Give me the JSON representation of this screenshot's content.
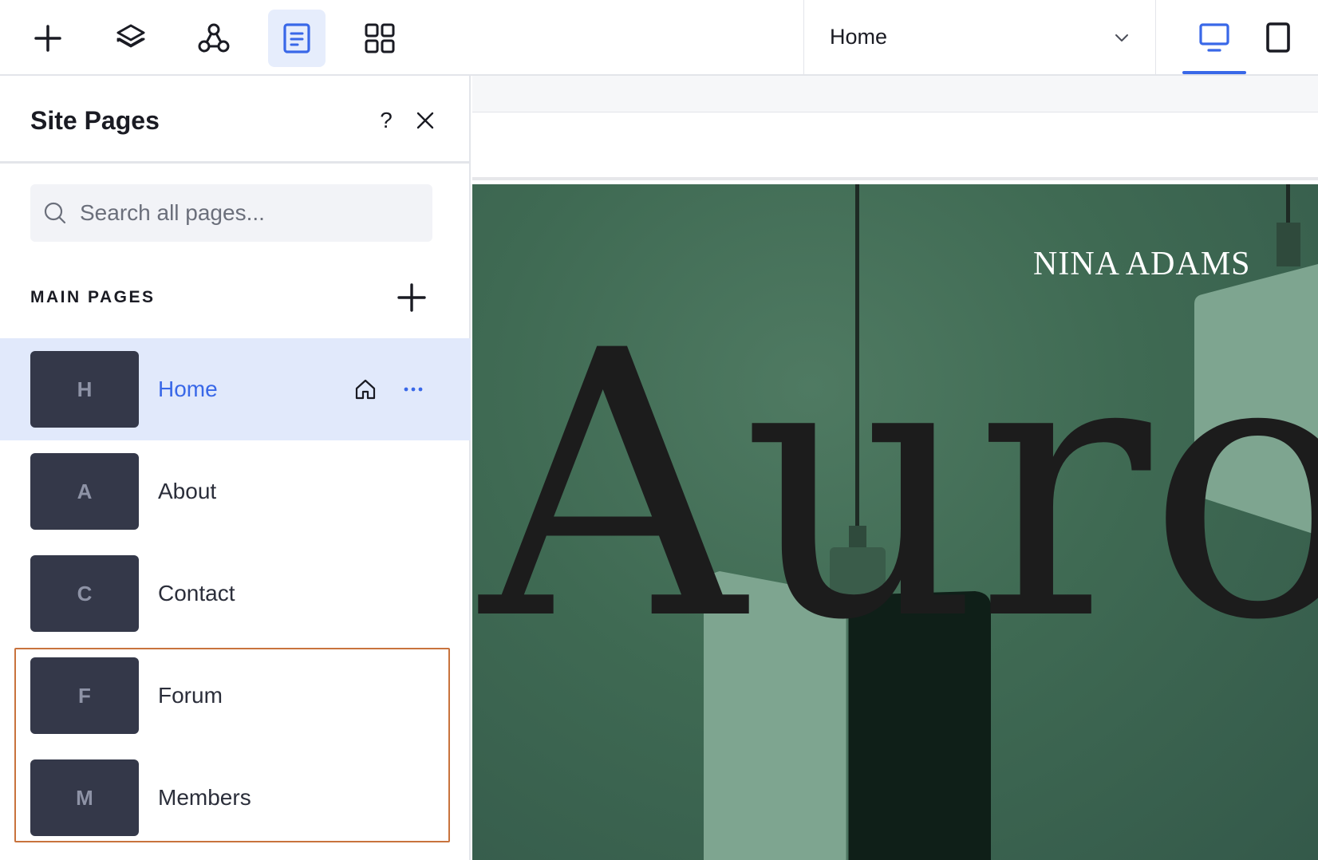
{
  "toolbar": {
    "tools": [
      {
        "name": "add-icon"
      },
      {
        "name": "layers-icon"
      },
      {
        "name": "connections-icon"
      },
      {
        "name": "pages-icon",
        "active": true
      },
      {
        "name": "apps-icon"
      }
    ],
    "page_selector": {
      "label": "Home"
    },
    "devices": [
      {
        "name": "desktop-icon",
        "active": true
      },
      {
        "name": "mobile-icon",
        "active": false
      }
    ]
  },
  "panel": {
    "title": "Site Pages",
    "help": "?",
    "search": {
      "placeholder": "Search all pages..."
    },
    "section_title": "MAIN PAGES",
    "pages": [
      {
        "initial": "H",
        "label": "Home",
        "selected": true
      },
      {
        "initial": "A",
        "label": "About"
      },
      {
        "initial": "C",
        "label": "Contact"
      },
      {
        "initial": "F",
        "label": "Forum"
      },
      {
        "initial": "M",
        "label": "Members"
      }
    ]
  },
  "canvas": {
    "brand": "NINA ADAMS",
    "hero_text": "Auro"
  },
  "colors": {
    "accent": "#3968e8",
    "selected_row": "#e1e9fb",
    "thumb": "#343849",
    "highlight": "#c8733d",
    "hero_bg": "#3f6a53"
  }
}
